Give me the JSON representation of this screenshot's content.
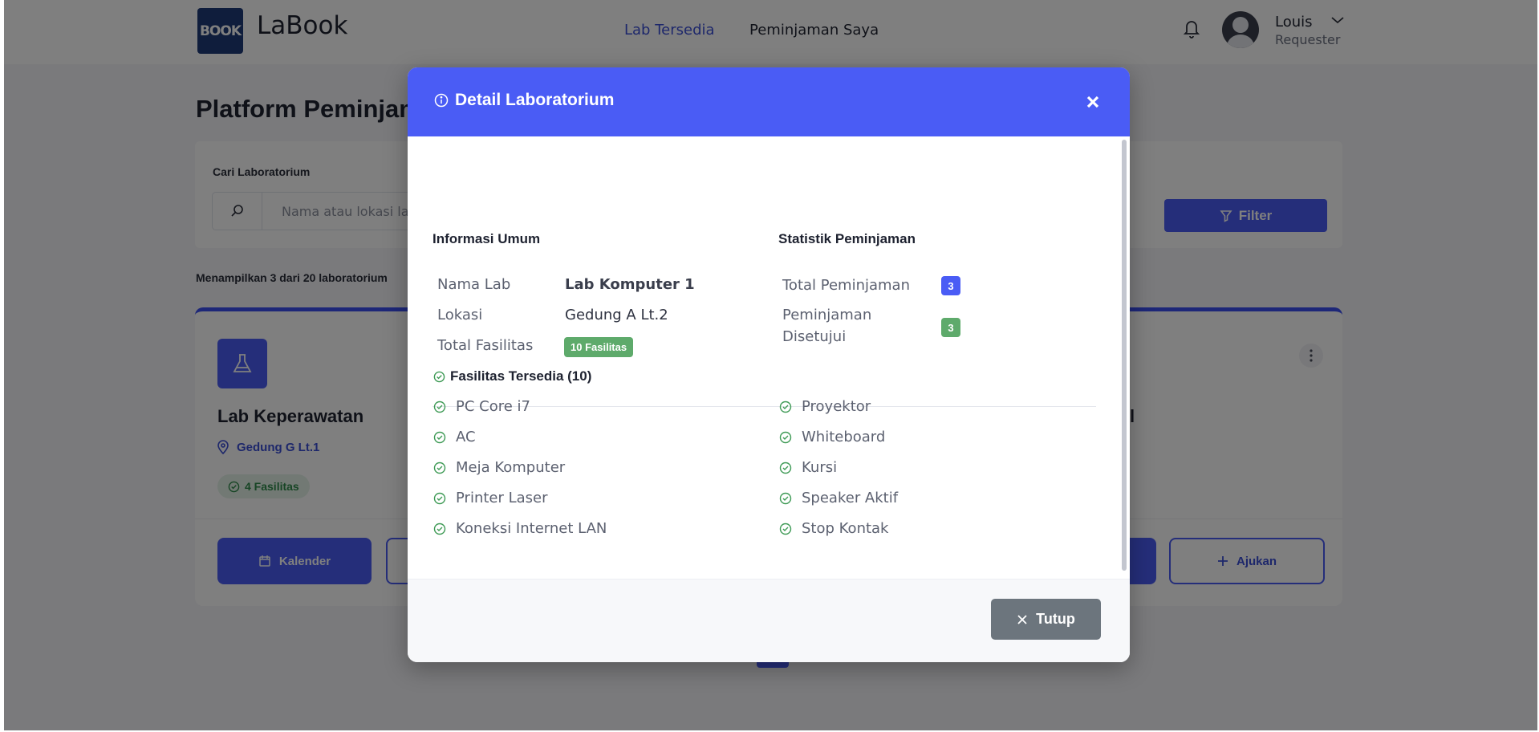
{
  "app": {
    "logo_text": "BOOK",
    "name": "LaBook"
  },
  "nav": {
    "items": [
      {
        "label": "Lab Tersedia",
        "active": true
      },
      {
        "label": "Peminjaman Saya",
        "active": false
      }
    ]
  },
  "user": {
    "name": "Louis",
    "role": "Requester"
  },
  "page": {
    "title": "Platform Peminjaman Laboratorium",
    "search_label": "Cari Laboratorium",
    "search_placeholder": "Nama atau lokasi laboratorium",
    "filter_label": "Filter",
    "result_info": "Menampilkan 3 dari 20 laboratorium"
  },
  "cards": [
    {
      "name": "Lab Keperawatan",
      "location": "Gedung G Lt.1",
      "facilities_badge": "4 Fasilitas",
      "primary_button": "Kalender"
    },
    {
      "name_fragment": "l",
      "secondary_button": "Ajukan"
    }
  ],
  "modal": {
    "title": "Detail Laboratorium",
    "general_section": "Informasi Umum",
    "stats_section": "Statistik Peminjaman",
    "info": {
      "name_label": "Nama Lab",
      "name_value": "Lab Komputer 1",
      "location_label": "Lokasi",
      "location_value": "Gedung A Lt.2",
      "facility_label": "Total Fasilitas",
      "facility_value": "10 Fasilitas"
    },
    "stats": {
      "total_label": "Total Peminjaman",
      "total_value": "3",
      "approved_label": "Peminjaman Disetujui",
      "approved_value": "3"
    },
    "facilities_title": "Fasilitas Tersedia (10)",
    "facilities_left": [
      "PC Core i7",
      "AC",
      "Meja Komputer",
      "Printer Laser",
      "Koneksi Internet LAN"
    ],
    "facilities_right": [
      "Proyektor",
      "Whiteboard",
      "Kursi",
      "Speaker Aktif",
      "Stop Kontak"
    ],
    "close_button": "Tutup"
  },
  "colors": {
    "primary": "#4a5cf5",
    "success": "#5eaa6b",
    "secondary": "#6c757d"
  }
}
